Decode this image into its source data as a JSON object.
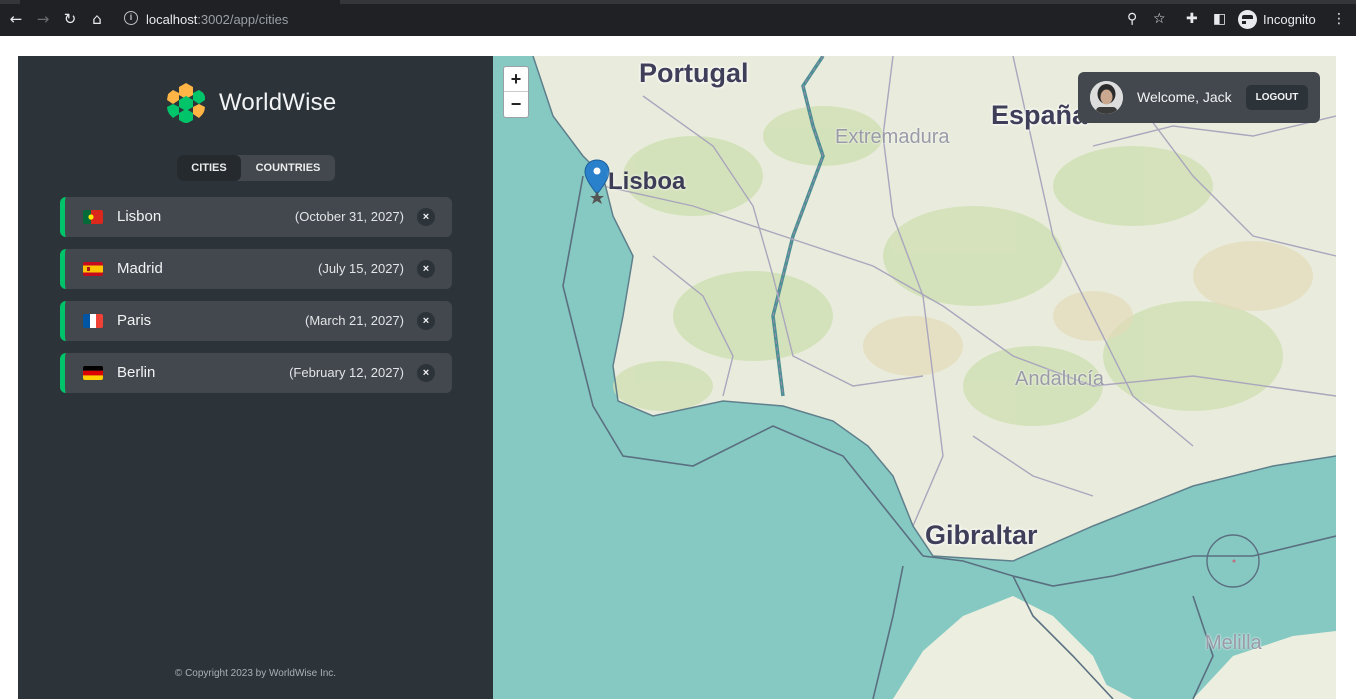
{
  "browser": {
    "url_host": "localhost",
    "url_path": ":3002/app/cities",
    "profile_label": "Incognito",
    "icons": [
      "back-icon",
      "forward-icon",
      "reload-icon",
      "home-icon",
      "info-icon",
      "location-icon",
      "star-icon",
      "extensions-icon",
      "sidepanel-icon",
      "incognito-icon",
      "menu-icon"
    ]
  },
  "app": {
    "logo_text": "WorldWise",
    "tabs": [
      {
        "label": "CITIES",
        "active": true
      },
      {
        "label": "COUNTRIES",
        "active": false
      }
    ],
    "cities": [
      {
        "name": "Lisbon",
        "date": "(October 31, 2027)",
        "flag": "portugal",
        "delete_label": "×"
      },
      {
        "name": "Madrid",
        "date": "(July 15, 2027)",
        "flag": "spain",
        "delete_label": "×"
      },
      {
        "name": "Paris",
        "date": "(March 21, 2027)",
        "flag": "france",
        "delete_label": "×"
      },
      {
        "name": "Berlin",
        "date": "(February 12, 2027)",
        "flag": "germany",
        "delete_label": "×"
      }
    ],
    "accent_color": "#00c46a",
    "copyright": "© Copyright 2023 by WorldWise Inc."
  },
  "map": {
    "zoom_in": "+",
    "zoom_out": "−",
    "labels": {
      "portugal": "Portugal",
      "espana": "España",
      "extremadura": "Extremadura",
      "lisboa": "Lisboa",
      "andalucia": "Andalucía",
      "gibraltar": "Gibraltar",
      "melilla": "Melilla"
    }
  },
  "user": {
    "welcome": "Welcome, Jack",
    "logout_label": "LOGOUT"
  }
}
